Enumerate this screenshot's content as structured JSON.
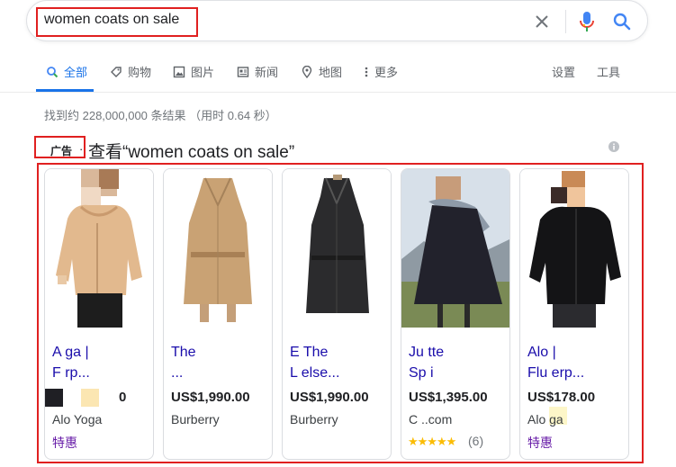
{
  "search": {
    "query": "women coats on sale"
  },
  "tabs": [
    {
      "label": "全部",
      "icon": "search-icon",
      "active": true
    },
    {
      "label": "购物",
      "icon": "tag-icon"
    },
    {
      "label": "图片",
      "icon": "image-icon"
    },
    {
      "label": "新闻",
      "icon": "news-icon"
    },
    {
      "label": "地图",
      "icon": "map-pin-icon"
    },
    {
      "label": "更多",
      "icon": "more-vert-icon"
    }
  ],
  "tools": {
    "settings_label": "设置",
    "tools_label": "工具"
  },
  "result_stats": "找到约 228,000,000 条结果 （用时 0.64 秒）",
  "ad": {
    "label": "广告",
    "separator": "·",
    "title": "查看“women coats on sale”"
  },
  "colors": {
    "link": "#1a0dab",
    "sale": "#681da8",
    "accent": "#1a73e8",
    "highlight_box": "#e02020",
    "stars": "#fbbc04"
  },
  "products": [
    {
      "name_line1": "A      ga |",
      "name_line2": "F         rp...",
      "price": "0",
      "merchant": "Alo Yoga",
      "tag": "特惠"
    },
    {
      "name_line1": "        The",
      "name_line2": "              ...",
      "price": "US$1,990.00",
      "merchant": "Burberry"
    },
    {
      "name_line1": "E          The",
      "name_line2": "L          else...",
      "price": "US$1,990.00",
      "merchant": "Burberry"
    },
    {
      "name_line1": "Ju      tte",
      "name_line2": "Sp       i",
      "price": "US$1,395.00",
      "merchant": "C     ..com",
      "stars": "★★★★★",
      "reviews": "(6)"
    },
    {
      "name_line1": "Alo       |",
      "name_line2": "Flu        erp...",
      "price": "US$178.00",
      "merchant": "Alo    ga",
      "tag": "特惠"
    }
  ]
}
